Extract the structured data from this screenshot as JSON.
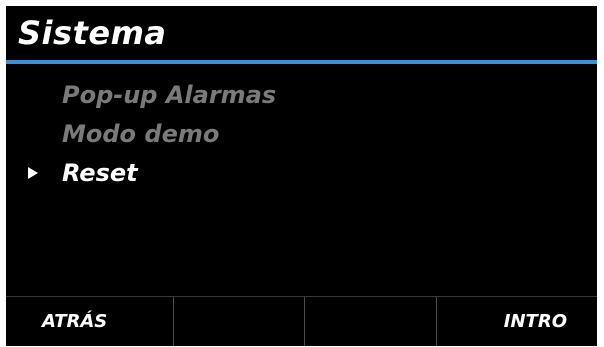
{
  "header": {
    "title": "Sistema",
    "accent_color": "#3c8fd6"
  },
  "menu": {
    "items": [
      {
        "label": "Pop-up Alarmas",
        "state": "disabled"
      },
      {
        "label": "Modo demo",
        "state": "disabled"
      },
      {
        "label": "Reset",
        "state": "selected"
      }
    ],
    "selection_marker_icon": "triangle-right-icon"
  },
  "softkeys": {
    "key1": "ATRÁS",
    "key2": "",
    "key3": "",
    "key4": "INTRO"
  }
}
